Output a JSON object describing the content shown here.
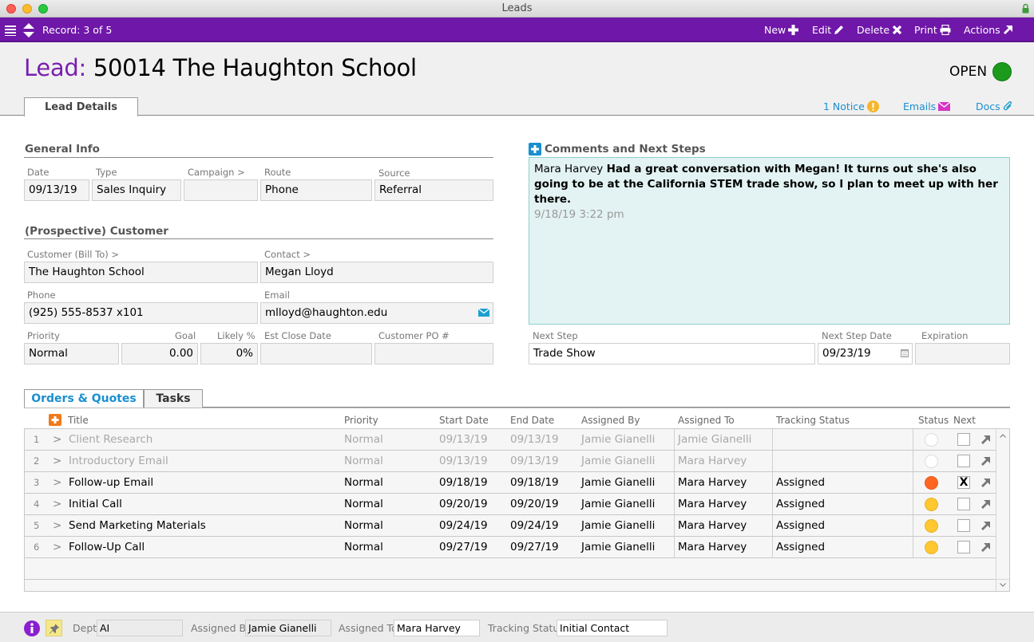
{
  "window": {
    "title": "Leads"
  },
  "toolbar": {
    "record_label": "Record: 3 of 5",
    "new_label": "New",
    "edit_label": "Edit",
    "delete_label": "Delete",
    "print_label": "Print",
    "actions_label": "Actions"
  },
  "header": {
    "prefix": "Lead:",
    "title": "50014 The Haughton School",
    "status_text": "OPEN",
    "status_color": "#1c9a1c"
  },
  "tabs": {
    "lead_details": "Lead Details"
  },
  "toplinks": {
    "notice": "1 Notice",
    "emails": "Emails",
    "docs": "Docs"
  },
  "general_info": {
    "heading": "General Info",
    "date": {
      "label": "Date",
      "value": "09/13/19"
    },
    "type": {
      "label": "Type",
      "value": "Sales Inquiry"
    },
    "campaign": {
      "label": "Campaign >",
      "value": ""
    },
    "route": {
      "label": "Route",
      "value": "Phone"
    },
    "source": {
      "label": "Source",
      "value": "Referral"
    }
  },
  "customer": {
    "heading": "(Prospective) Customer",
    "bill_to": {
      "label": "Customer (Bill To) >",
      "value": "The Haughton School"
    },
    "contact": {
      "label": "Contact >",
      "value": "Megan Lloyd"
    },
    "phone": {
      "label": "Phone",
      "value": "(925) 555-8537 x101"
    },
    "email": {
      "label": "Email",
      "value": "mlloyd@haughton.edu"
    },
    "priority": {
      "label": "Priority",
      "value": "Normal"
    },
    "goal": {
      "label": "Goal",
      "value": "0.00"
    },
    "likely": {
      "label": "Likely %",
      "value": "0%"
    },
    "est_close": {
      "label": "Est Close Date",
      "value": ""
    },
    "po": {
      "label": "Customer PO #",
      "value": ""
    }
  },
  "comments": {
    "heading": "Comments and Next Steps",
    "author": "Mara Harvey",
    "text": "Had a great conversation with Megan! It turns out she's also going to be at the California STEM trade show, so I plan to meet up with her there.",
    "timestamp": "9/18/19  3:22 pm",
    "next_step": {
      "label": "Next Step",
      "value": "Trade Show"
    },
    "next_step_date": {
      "label": "Next Step Date",
      "value": "09/23/19"
    },
    "expiration": {
      "label": "Expiration",
      "value": ""
    }
  },
  "subtabs": {
    "orders": "Orders & Quotes",
    "tasks": "Tasks"
  },
  "tasks": {
    "columns": {
      "title": "Title",
      "priority": "Priority",
      "start": "Start Date",
      "end": "End Date",
      "assigned_by": "Assigned By",
      "assigned_to": "Assigned To",
      "tracking": "Tracking Status",
      "status": "Status",
      "next": "Next"
    },
    "rows": [
      {
        "num": "1",
        "title": "Client Research",
        "priority": "Normal",
        "start": "09/13/19",
        "end": "09/13/19",
        "assigned_by": "Jamie Gianelli",
        "assigned_to": "Jamie Gianelli",
        "tracking": "",
        "status_color": "#ffffff",
        "next": "",
        "dim": true
      },
      {
        "num": "2",
        "title": "Introductory Email",
        "priority": "Normal",
        "start": "09/13/19",
        "end": "09/13/19",
        "assigned_by": "Jamie Gianelli",
        "assigned_to": "Mara Harvey",
        "tracking": "",
        "status_color": "#ffffff",
        "next": "",
        "dim": true
      },
      {
        "num": "3",
        "title": "Follow-up Email",
        "priority": "Normal",
        "start": "09/18/19",
        "end": "09/18/19",
        "assigned_by": "Jamie Gianelli",
        "assigned_to": "Mara Harvey",
        "tracking": "Assigned",
        "status_color": "#ff6622",
        "next": "X",
        "dim": false
      },
      {
        "num": "4",
        "title": "Initial Call",
        "priority": "Normal",
        "start": "09/20/19",
        "end": "09/20/19",
        "assigned_by": "Jamie Gianelli",
        "assigned_to": "Mara Harvey",
        "tracking": "Assigned",
        "status_color": "#ffc830",
        "next": "",
        "dim": false
      },
      {
        "num": "5",
        "title": "Send Marketing Materials",
        "priority": "Normal",
        "start": "09/24/19",
        "end": "09/24/19",
        "assigned_by": "Jamie Gianelli",
        "assigned_to": "Mara Harvey",
        "tracking": "Assigned",
        "status_color": "#ffc830",
        "next": "",
        "dim": false
      },
      {
        "num": "6",
        "title": "Follow-Up Call",
        "priority": "Normal",
        "start": "09/27/19",
        "end": "09/27/19",
        "assigned_by": "Jamie Gianelli",
        "assigned_to": "Mara Harvey",
        "tracking": "Assigned",
        "status_color": "#ffc830",
        "next": "",
        "dim": false
      }
    ]
  },
  "footer": {
    "dept": {
      "label": "Dept",
      "value": "AI"
    },
    "assigned_by": {
      "label": "Assigned By",
      "value": "Jamie Gianelli"
    },
    "assigned_to": {
      "label": "Assigned To",
      "value": "Mara Harvey"
    },
    "tracking": {
      "label": "Tracking Status",
      "value": "Initial Contact"
    }
  }
}
